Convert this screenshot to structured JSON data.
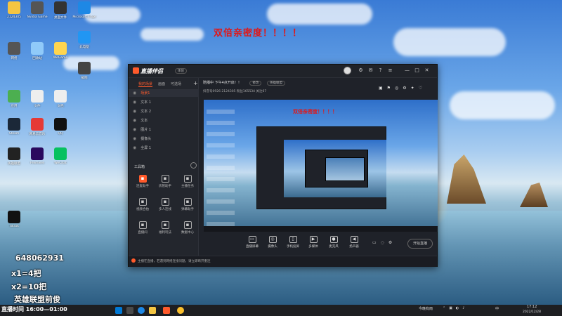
{
  "headline": "双倍亲密度！！！！",
  "desktop_icons": [
    {
      "label": "2124305",
      "icon": "folder-icon",
      "color": "#f4c542"
    },
    {
      "label": "Nvidia Game",
      "icon": "app-icon",
      "color": "#555"
    },
    {
      "label": "桌面文件",
      "icon": "folder-icon",
      "color": "#333"
    },
    {
      "label": "Microsoft Edge",
      "icon": "edge-icon",
      "color": "#1e88e5"
    },
    {
      "label": "此电脑",
      "icon": "computer-icon",
      "color": "#2196f3"
    },
    {
      "label": "网络",
      "icon": "network-icon",
      "color": "#555"
    },
    {
      "label": "回收站",
      "icon": "recycle-bin-icon",
      "color": "#90caf9"
    },
    {
      "label": "WeGame",
      "icon": "app-icon",
      "color": "#ffd54f"
    },
    {
      "label": "截图",
      "icon": "app-icon",
      "color": "#444"
    },
    {
      "label": "应用",
      "icon": "app-icon",
      "color": "#4caf50"
    },
    {
      "label": "文件",
      "icon": "file-icon",
      "color": "#eee"
    },
    {
      "label": "文档",
      "icon": "file-icon",
      "color": "#eee"
    },
    {
      "label": "Steam",
      "icon": "steam-icon",
      "color": "#1b2838"
    },
    {
      "label": "网易云音乐",
      "icon": "music-icon",
      "color": "#e53935"
    },
    {
      "label": "QQ",
      "icon": "qq-icon",
      "color": "#111"
    },
    {
      "label": "英雄联盟",
      "icon": "game-icon",
      "color": "#222"
    },
    {
      "label": "Premiere",
      "icon": "premiere-icon",
      "color": "#2a0a5e"
    },
    {
      "label": "WeChat",
      "icon": "wechat-icon",
      "color": "#07c160"
    },
    {
      "label": "TikTok",
      "icon": "tiktok-icon",
      "color": "#111"
    }
  ],
  "app": {
    "logo": "直播伴侣",
    "badge": "体验",
    "window_controls": [
      "—",
      "□",
      "✕"
    ],
    "tabs": [
      {
        "label": "我的场景",
        "active": true
      },
      {
        "label": "画面",
        "active": false
      },
      {
        "label": "可选场",
        "active": false
      }
    ],
    "scenes": [
      {
        "label": "场景1",
        "selected": true
      },
      {
        "label": "文本 1",
        "selected": false
      },
      {
        "label": "文本 2",
        "selected": false
      },
      {
        "label": "文本",
        "selected": false
      },
      {
        "label": "图片 1",
        "selected": false
      },
      {
        "label": "摄像头",
        "selected": false
      },
      {
        "label": "全屏 1",
        "selected": false
      }
    ],
    "tools_title": "工具箱",
    "tools": [
      {
        "label": "连麦助手",
        "icon": "mic-tool-icon",
        "hot": true
      },
      {
        "label": "房管助手",
        "icon": "user-icon",
        "hot": false
      },
      {
        "label": "主播任务",
        "icon": "task-icon",
        "hot": false
      },
      {
        "label": "视频合拍",
        "icon": "video-icon",
        "hot": false
      },
      {
        "label": "多人连线",
        "icon": "people-icon",
        "hot": false
      },
      {
        "label": "弹幕助手",
        "icon": "chat-icon",
        "hot": false
      },
      {
        "label": "直播间",
        "icon": "room-icon",
        "hot": false
      },
      {
        "label": "福利玩法",
        "icon": "gift-icon",
        "hot": false
      },
      {
        "label": "数据中心",
        "icon": "data-icon",
        "hot": false
      }
    ],
    "stream_title": "陪播中 下午4点开启！！",
    "stream_edit": "修改",
    "stream_category": "英雄联盟",
    "stats_line": "抖音号0926   2124305   粉丝165534   关注67",
    "bottom_tools": [
      {
        "label": "直播屏幕",
        "icon": "screen-icon"
      },
      {
        "label": "摄像头",
        "icon": "camera-icon"
      },
      {
        "label": "手机投屏",
        "icon": "phone-icon"
      },
      {
        "label": "多媒体",
        "icon": "media-icon"
      },
      {
        "label": "麦克风",
        "icon": "mic-icon"
      },
      {
        "label": "扬声器",
        "icon": "speaker-icon"
      }
    ],
    "start_button": "开始直播",
    "notice": "主播在直播，若遇到网络连接问题，请立即断开重连"
  },
  "overlay": {
    "qq_number": "648062931",
    "rule1": "x1=4把",
    "rule2": "x2=10把",
    "subtitle": "英雄联盟前俊",
    "live_time": "直播时间 16:00—01:00"
  },
  "taskbar": {
    "time": "17:12",
    "date": "2022/12/28",
    "weather": "今晚有雨",
    "lang": "中"
  }
}
